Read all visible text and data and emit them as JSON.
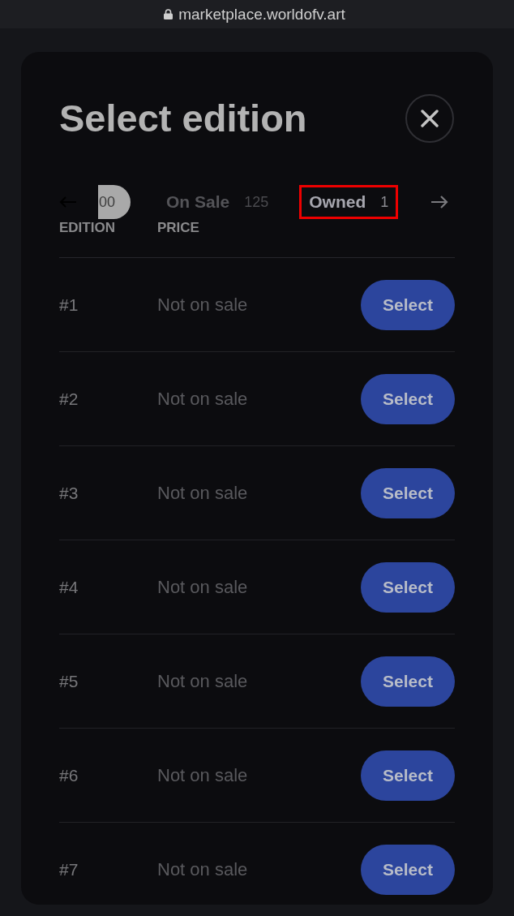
{
  "browser": {
    "url": "marketplace.worldofv.art"
  },
  "modal": {
    "title": "Select edition"
  },
  "tabs": [
    {
      "count": "00",
      "selected": true,
      "highlighted": false
    },
    {
      "label": "On Sale",
      "count": "125",
      "selected": false,
      "highlighted": false
    },
    {
      "label": "Owned",
      "count": "1",
      "selected": false,
      "highlighted": true
    }
  ],
  "columns": [
    "EDITION",
    "PRICE"
  ],
  "rows": [
    {
      "edition": "#1",
      "price": "Not on sale",
      "action": "Select"
    },
    {
      "edition": "#2",
      "price": "Not on sale",
      "action": "Select"
    },
    {
      "edition": "#3",
      "price": "Not on sale",
      "action": "Select"
    },
    {
      "edition": "#4",
      "price": "Not on sale",
      "action": "Select"
    },
    {
      "edition": "#5",
      "price": "Not on sale",
      "action": "Select"
    },
    {
      "edition": "#6",
      "price": "Not on sale",
      "action": "Select"
    },
    {
      "edition": "#7",
      "price": "Not on sale",
      "action": "Select"
    }
  ]
}
